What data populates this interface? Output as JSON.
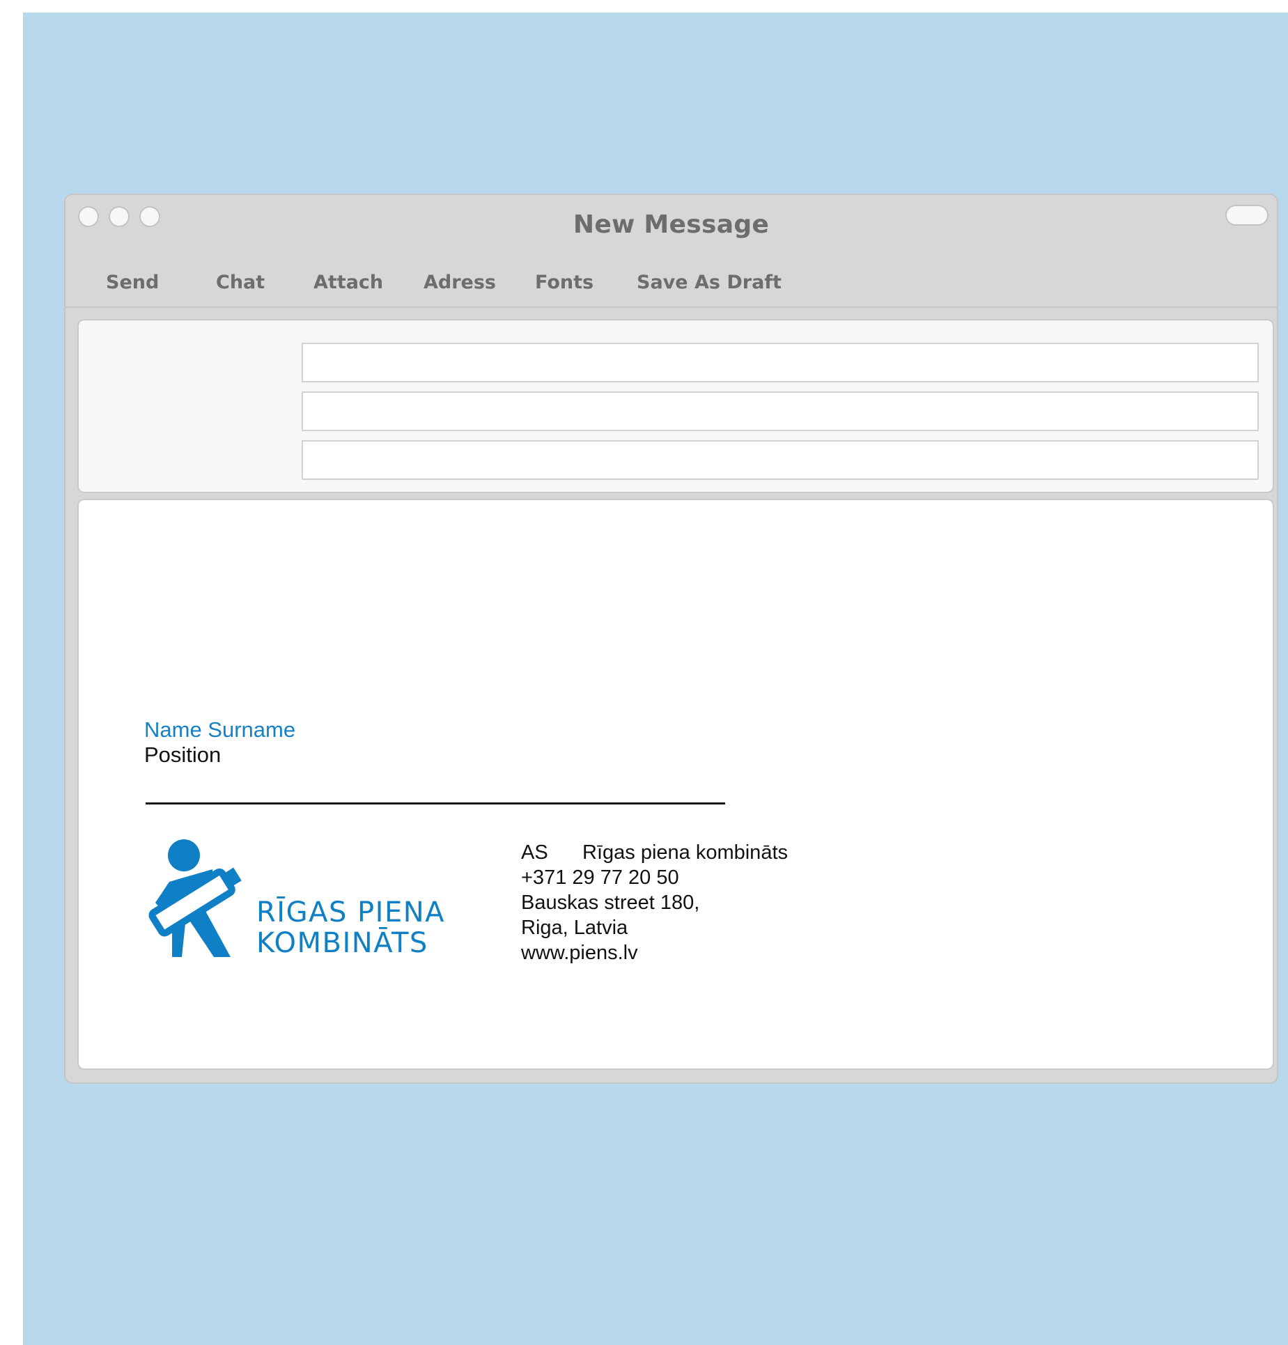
{
  "window": {
    "title": "New Message"
  },
  "toolbar": {
    "send": "Send",
    "chat": "Chat",
    "attach": "Attach",
    "address": "Adress",
    "fonts": "Fonts",
    "save_as_draft": "Save As Draft"
  },
  "fields": {
    "to": "",
    "cc": "",
    "subject": ""
  },
  "signature": {
    "name": "Name Surname",
    "position": "Position",
    "logo": {
      "line1": "RĪGAS PIENA",
      "line2": "KOMBINĀTS"
    },
    "company_prefix": "AS",
    "company_name": "Rīgas piena kombināts",
    "phone": "+371 29 77 20 50",
    "street": "Bauskas street 180,",
    "city": "Riga, Latvia",
    "website": "www.piens.lv"
  },
  "colors": {
    "backdrop": "#b8d9eb",
    "window_chrome": "#d6d8d8",
    "brand_blue": "#0f7fc6",
    "name_blue": "#1481c7",
    "toolbar_text": "#6b6d6f"
  }
}
